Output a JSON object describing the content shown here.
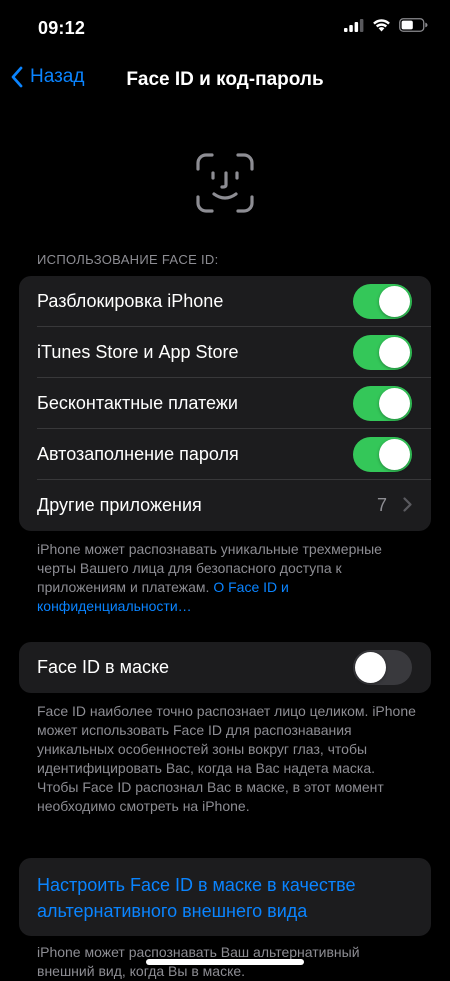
{
  "status": {
    "time": "09:12",
    "battery_level": 0.55
  },
  "nav": {
    "back_label": "Назад",
    "title": "Face ID и код-пароль"
  },
  "section1": {
    "header": "ИСПОЛЬЗОВАНИЕ FACE ID:",
    "rows": [
      {
        "label": "Разблокировка iPhone",
        "on": true
      },
      {
        "label": "iTunes Store и App Store",
        "on": true
      },
      {
        "label": "Бесконтактные платежи",
        "on": true
      },
      {
        "label": "Автозаполнение пароля",
        "on": true
      }
    ],
    "other_apps": {
      "label": "Другие приложения",
      "value": "7"
    },
    "footer_text": "iPhone может распознавать уникальные трехмерные черты Вашего лица для безопасного доступа к приложениям и платежам. ",
    "footer_link": "О Face ID и конфиденциальности…"
  },
  "section2": {
    "mask_label": "Face ID в маске",
    "mask_on": false,
    "footer_text": "Face ID наиболее точно распознает лицо целиком. iPhone может использовать Face ID для распознавания уникальных особенностей зоны вокруг глаз, чтобы идентифицировать Вас, когда на Вас надета маска. Чтобы Face ID распознал Вас в маске, в этот момент необходимо смотреть на iPhone."
  },
  "section3": {
    "action_label": "Настроить Face ID в маске в качестве альтернативного внешнего вида",
    "footer_text": "iPhone может распознавать Ваш альтернативный внешний вид, когда Вы в маске."
  },
  "colors": {
    "accent": "#0a84ff",
    "toggle_on": "#34c759",
    "toggle_off": "#39393d",
    "cell_bg": "#1c1c1e",
    "secondary_text": "#8d8d93"
  },
  "icons": {
    "back": "chevron-left-icon",
    "faceid": "face-id-icon",
    "chevron": "chevron-right-icon",
    "signal": "cellular-signal-icon",
    "wifi": "wifi-icon",
    "battery": "battery-icon"
  }
}
